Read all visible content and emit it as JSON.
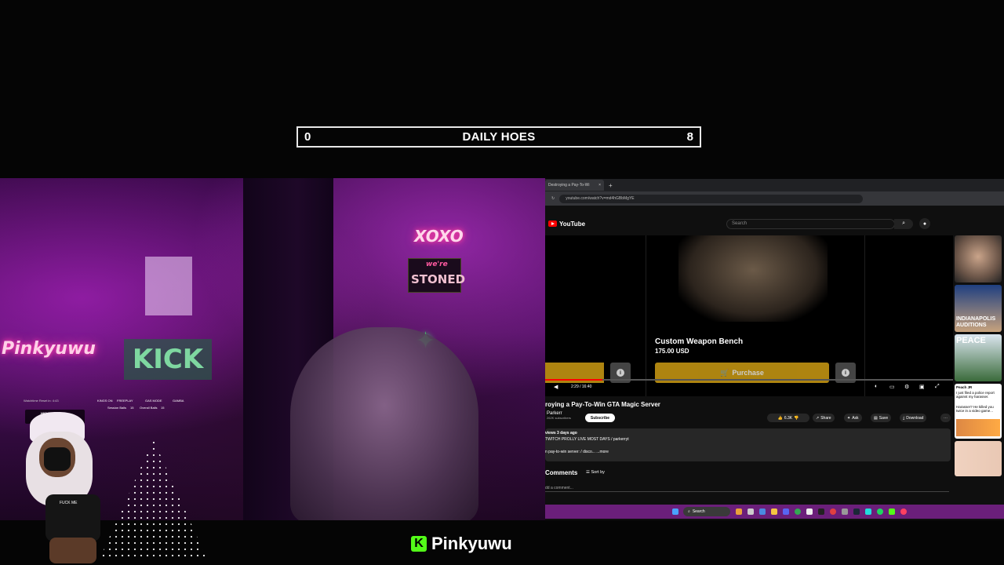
{
  "counter": {
    "left": "0",
    "title": "DAILY HOES",
    "right": "8"
  },
  "camera": {
    "neon_xoxo": "XOXO",
    "neon_stoned": "STONED",
    "neon_were": "we're",
    "neon_pinkyuwu": "Pinkyuwu",
    "sign_kick": "KICK",
    "hud": {
      "watchtime": "Watchtime Reset in: 4:43",
      "high_scores": "HIGH SCORES",
      "kings": "KINGS ON",
      "freeplay": "FREEPLAY",
      "gas_mode": "GAS MODE",
      "gamba": "GAMBA",
      "session_balls": "Session Balls",
      "session_balls_val": "15",
      "overall_balls": "Overall Balls",
      "overall_balls_val": "15",
      "avatar_shirt": "FUCK ME"
    }
  },
  "browser": {
    "tab_title": "Destroying a Pay-To-Wi",
    "tab_close": "×",
    "new_tab": "+",
    "url": "youtube.com/watch?v=md4hGBbMgYE",
    "yt_logo": "YouTube",
    "search_placeholder": "Search",
    "player": {
      "item_name": "Custom Weapon Bench",
      "item_price": "175.00 USD",
      "purchase": "Purchase",
      "time": "2:29 / 16:40"
    },
    "video_title": "roying a Pay-To-Win GTA Magic Server",
    "channel": "Parkerr",
    "subs": "262K subscribers",
    "subscribe": "Subscribe",
    "likes": "6.3K",
    "share": "Share",
    "ask": "Ask",
    "save": "Save",
    "download": "Download",
    "desc_line1": "views  3 days ago",
    "desc_line2": "TWITCH PROLLY LIVE MOST DAYS  / parkerryt",
    "desc_line3": "n pay-to-win server:  / disco...  ...more",
    "comments": "Comments",
    "sort_by": "Sort by",
    "add_comment": "dd a comment...",
    "sidebar": {
      "thumb3_text": "INDIANAPOLIS AUDITIONS",
      "thumb4_text": "PEACE",
      "chat_name": "Peach JR",
      "chat_line1": "I just filed a police report against my harasser.",
      "chat_line2": "Harasser? He killed you twice in a video game..."
    },
    "taskbar_search": "Search"
  },
  "brand": {
    "name": "Pinkyuwu",
    "icon_letter": "K"
  },
  "colors": {
    "kick_green": "#53fc18",
    "yt_red": "#ff0000",
    "purchase_gold": "#d9a514",
    "taskbar_purple": "#6b1f7a"
  }
}
